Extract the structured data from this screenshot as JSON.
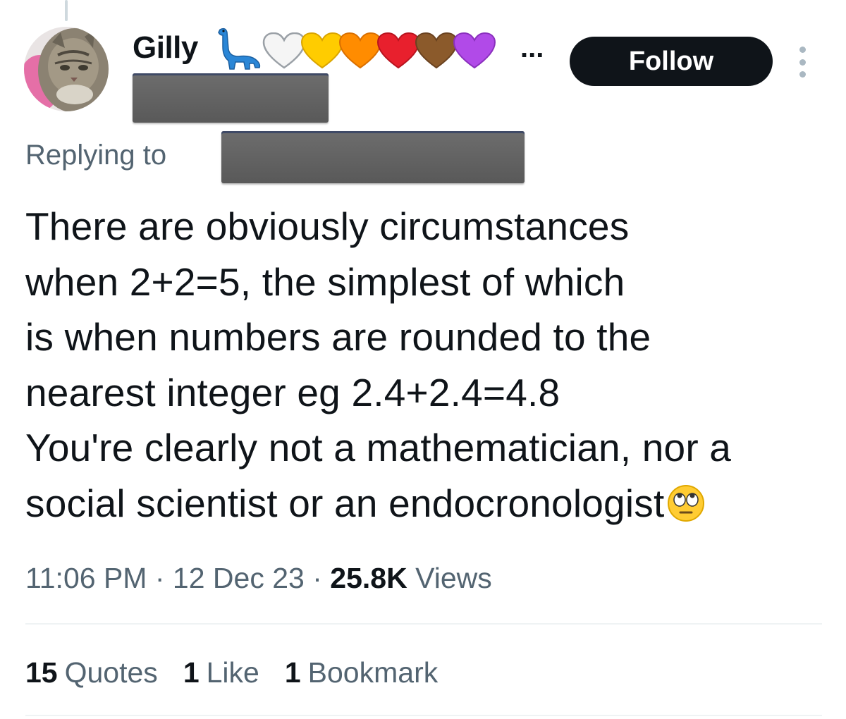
{
  "author": {
    "display_name": "Gilly",
    "name_emojis": [
      "dinosaur-emoji",
      "white-heart",
      "yellow-heart",
      "orange-heart",
      "red-heart",
      "brown-heart",
      "purple-heart"
    ],
    "truncation": "...",
    "handle_redacted": true
  },
  "actions": {
    "follow_label": "Follow",
    "more_icon": "more-vertical-icon"
  },
  "reply_context": {
    "label": "Replying to",
    "target_redacted": true
  },
  "tweet": {
    "lines": [
      "There are obviously circumstances",
      "when 2+2=5, the simplest of which",
      "is when numbers are rounded to the",
      "nearest integer eg 2.4+2.4=4.8",
      "You're clearly not a mathematician, nor a",
      "social scientist or an endocronologist"
    ],
    "trailing_emoji": "face-with-rolling-eyes"
  },
  "meta": {
    "time": "11:06 PM",
    "sep": "·",
    "date": "12 Dec 23",
    "views_count": "25.8K",
    "views_label": "Views"
  },
  "stats": [
    {
      "count": "15",
      "label": "Quotes"
    },
    {
      "count": "1",
      "label": "Like"
    },
    {
      "count": "1",
      "label": "Bookmark"
    }
  ],
  "colors": {
    "text": "#0f1419",
    "secondary": "#536471",
    "follow_bg": "#0f1419",
    "hearts": [
      "#f5f5f5",
      "#ffcc00",
      "#ff8c00",
      "#e8202d",
      "#8b5a2b",
      "#b14ae8"
    ],
    "dino": "#2a86d6"
  }
}
